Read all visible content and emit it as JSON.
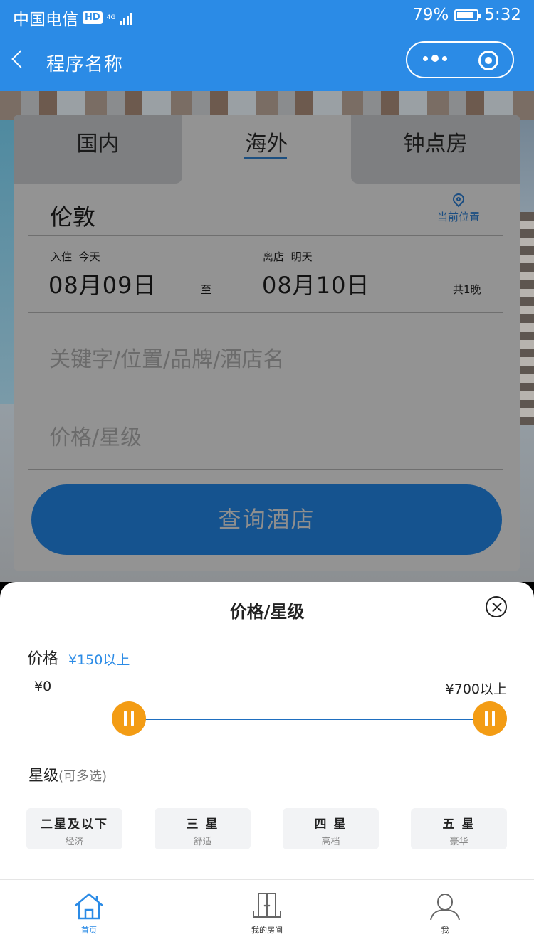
{
  "status_bar": {
    "carrier": "中国电信",
    "hd_badge": "HD",
    "network": "4G",
    "battery_percent": "79%",
    "battery_level": 0.79,
    "time": "5:32"
  },
  "navbar": {
    "title": "程序名称",
    "accent_color": "#2b8be6"
  },
  "search": {
    "tabs": [
      {
        "label": "国内",
        "active": false
      },
      {
        "label": "海外",
        "active": true
      },
      {
        "label": "钟点房",
        "active": false
      }
    ],
    "city": "伦敦",
    "current_location_label": "当前位置",
    "checkin_label": "入住",
    "checkin_day": "今天",
    "checkin_date": "08月09日",
    "to_label": "至",
    "checkout_label": "离店",
    "checkout_day": "明天",
    "checkout_date": "08月10日",
    "nights": "共1晚",
    "keyword_placeholder": "关键字/位置/品牌/酒店名",
    "price_star_placeholder": "价格/星级",
    "search_button": "查询酒店"
  },
  "filter_sheet": {
    "title": "价格/星级",
    "price_label": "价格",
    "price_value": "¥150以上",
    "price_min_label": "¥0",
    "price_max_label": "¥700以上",
    "slider_min_value": 150,
    "slider_max_value": 700,
    "slider_range": [
      0,
      700
    ],
    "handle_color": "#f39c14",
    "star_label": "星级",
    "star_sub": "(可多选)",
    "stars": [
      {
        "title": "二星及以下",
        "sub": "经济"
      },
      {
        "title": "三 星",
        "sub": "舒适"
      },
      {
        "title": "四 星",
        "sub": "高档"
      },
      {
        "title": "五 星",
        "sub": "豪华"
      }
    ]
  },
  "tabbar": {
    "items": [
      {
        "label": "首页",
        "icon": "home-icon",
        "active": true
      },
      {
        "label": "我的房间",
        "icon": "door-icon",
        "active": false
      },
      {
        "label": "我",
        "icon": "user-icon",
        "active": false
      }
    ]
  }
}
